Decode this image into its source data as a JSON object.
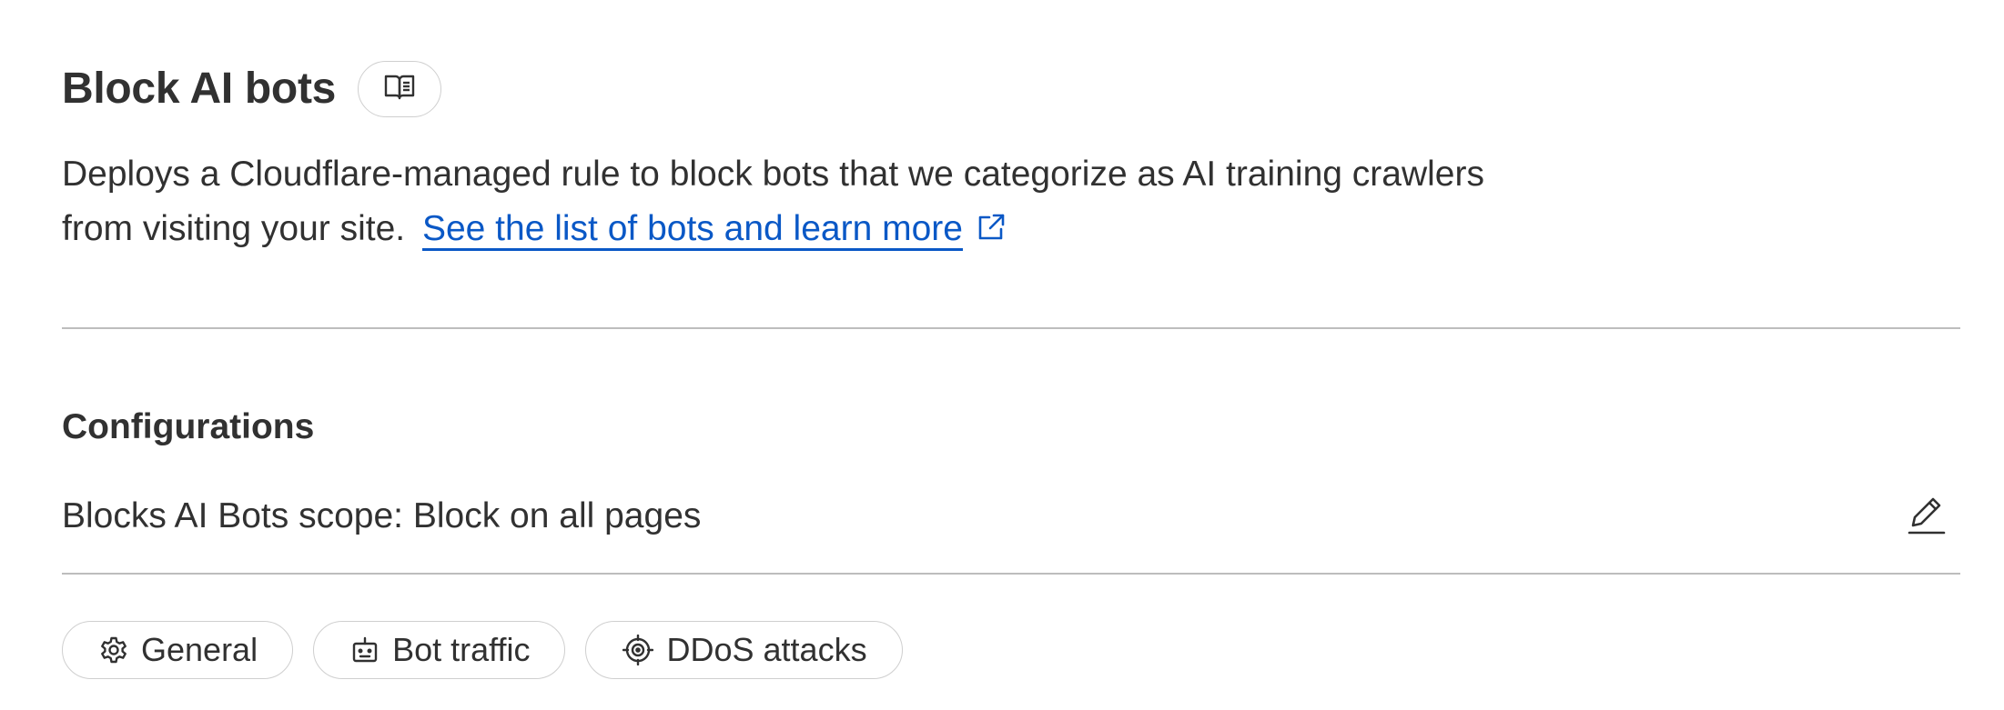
{
  "header": {
    "title": "Block AI bots",
    "doc_icon": "book-open-icon"
  },
  "description": {
    "text": "Deploys a Cloudflare-managed rule to block bots that we categorize as AI training crawlers from visiting your site.",
    "link_label": "See the list of bots and learn more",
    "link_icon": "external-link-icon"
  },
  "configurations": {
    "title": "Configurations",
    "scope_text": "Blocks AI Bots scope: Block on all pages",
    "edit_icon": "pencil-icon"
  },
  "tags": [
    {
      "label": "General",
      "icon": "gear-icon"
    },
    {
      "label": "Bot traffic",
      "icon": "robot-icon"
    },
    {
      "label": "DDoS attacks",
      "icon": "target-icon"
    }
  ],
  "colors": {
    "text": "#313131",
    "link": "#0a58c6",
    "border": "#cfcfcf",
    "divider": "#bdbdbd"
  }
}
